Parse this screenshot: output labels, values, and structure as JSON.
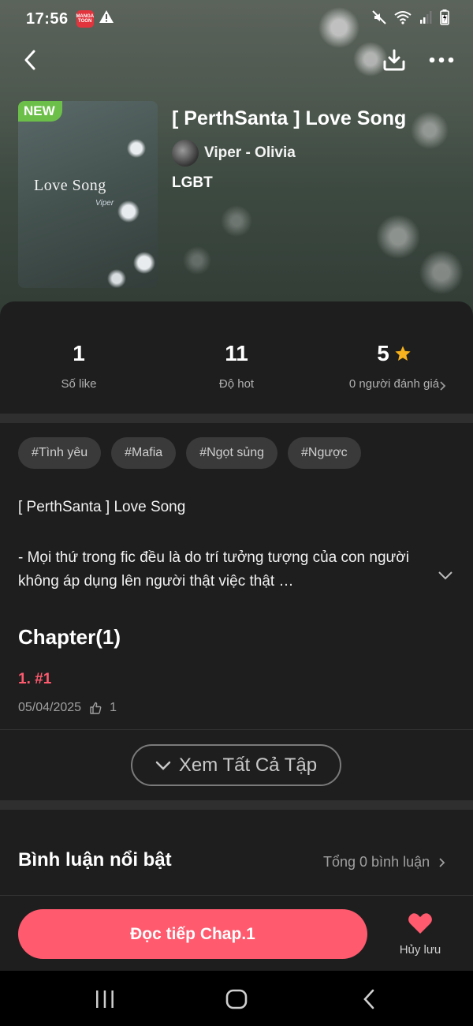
{
  "status_bar": {
    "time": "17:56",
    "app_badge": "MANGA TOON"
  },
  "header": {
    "badge": "NEW",
    "cover_title": "Love Song",
    "cover_subtitle": "Viper",
    "title": "[ PerthSanta ] Love Song",
    "author": "Viper - Olivia",
    "genre": "LGBT"
  },
  "stats": [
    {
      "value": "1",
      "label": "Số like"
    },
    {
      "value": "11",
      "label": "Độ hot"
    },
    {
      "value": "5",
      "label": "0 người đánh giá"
    }
  ],
  "tags": [
    "#Tình yêu",
    "#Mafia",
    "#Ngọt sủng",
    "#Ngược"
  ],
  "description": {
    "title": "[ PerthSanta ]  Love Song",
    "body": "- Mọi thứ trong fic đều là do trí tưởng tượng của con người không áp dụng lên người thật việc thật …"
  },
  "chapters": {
    "heading": "Chapter(1)",
    "items": [
      {
        "label": "1. #1",
        "date": "05/04/2025",
        "likes": "1"
      }
    ],
    "see_all": "Xem Tất Cả Tập"
  },
  "comments": {
    "heading": "Bình luận nổi bật",
    "count_text": "Tổng 0 bình luận"
  },
  "actions": {
    "read_label": "Đọc tiếp Chap.1",
    "unsave_label": "Hủy lưu"
  },
  "colors": {
    "accent": "#ff5a6e",
    "new_badge": "#6cc04a",
    "star": "#f7b21d"
  }
}
